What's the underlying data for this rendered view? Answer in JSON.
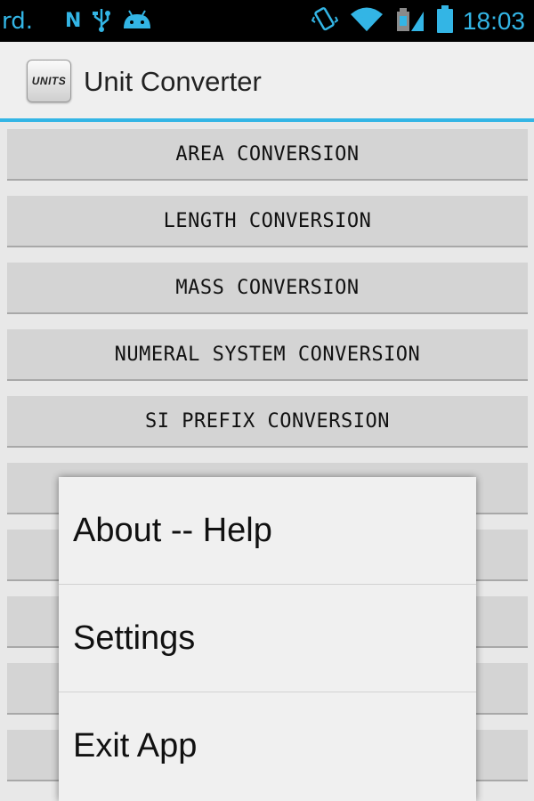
{
  "status_bar": {
    "left_text": "rd.",
    "n_label": "N",
    "time": "18:03",
    "icons": [
      "usb-icon",
      "android-icon",
      "vibrate-icon",
      "wifi-icon",
      "sim-icon",
      "battery-icon"
    ],
    "accent": "#33b5e5"
  },
  "action_bar": {
    "app_icon_text": "UNITS",
    "title": "Unit Converter"
  },
  "conversions": [
    "AREA CONVERSION",
    "LENGTH CONVERSION",
    "MASS CONVERSION",
    "NUMERAL SYSTEM CONVERSION",
    "SI PREFIX CONVERSION",
    "",
    "",
    "",
    "",
    ""
  ],
  "menu": {
    "items": [
      "About -- Help",
      "Settings",
      "Exit App"
    ]
  }
}
